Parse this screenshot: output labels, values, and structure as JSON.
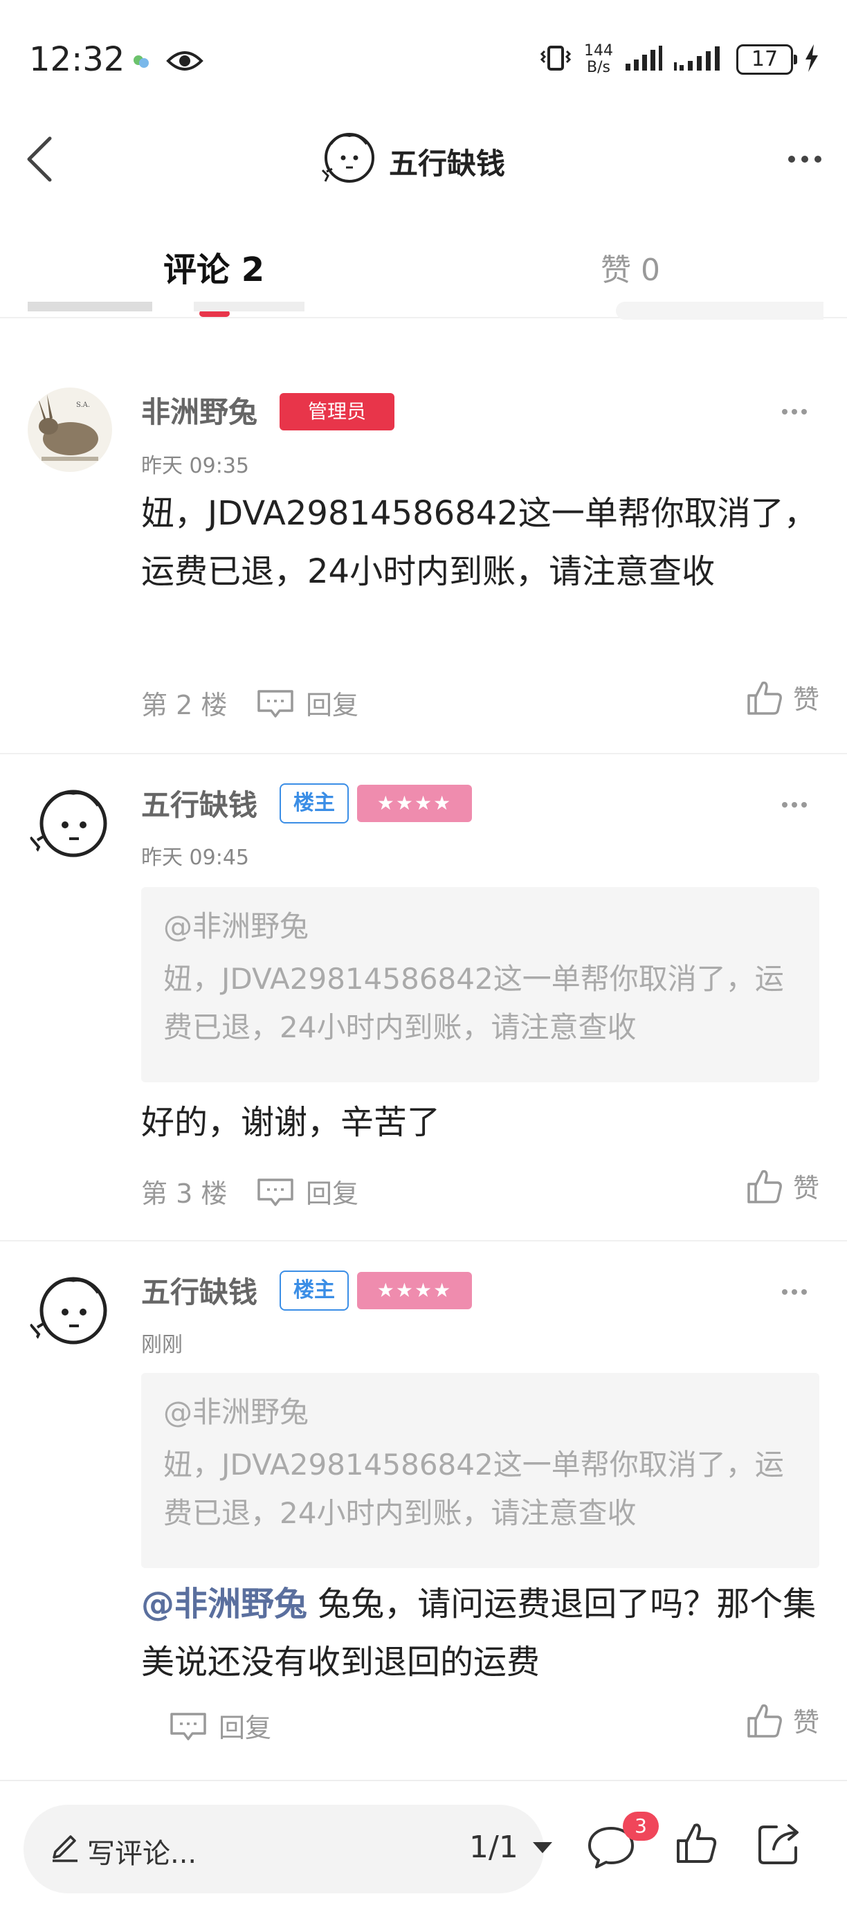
{
  "status_bar": {
    "time": "12:32",
    "net_speed_value": "144",
    "net_speed_unit": "B/s",
    "battery": "17"
  },
  "nav": {
    "title": "五行缺钱"
  },
  "tabs": {
    "comments": "评论 2",
    "likes": "赞 0"
  },
  "comments": [
    {
      "username": "非洲野兔",
      "badge": "管理员",
      "time": "昨天 09:35",
      "body": "妞，JDVA29814586842这一单帮你取消了，运费已退，24小时内到账，请注意查收",
      "floor": "第 2 楼",
      "reply": "回复",
      "like": "赞"
    },
    {
      "username": "五行缺钱",
      "badge": "楼主",
      "stars": "★★★★",
      "time": "昨天 09:45",
      "quote_user": "@非洲野兔",
      "quote_text": "妞，JDVA29814586842这一单帮你取消了，运费已退，24小时内到账，请注意查收",
      "body": "好的，谢谢，辛苦了",
      "floor": "第 3 楼",
      "reply": "回复",
      "like": "赞"
    },
    {
      "username": "五行缺钱",
      "badge": "楼主",
      "stars": "★★★★",
      "time": "刚刚",
      "quote_user": "@非洲野兔",
      "quote_text": "妞，JDVA29814586842这一单帮你取消了，运费已退，24小时内到账，请注意查收",
      "mention": "@非洲野兔",
      "body": " 兔兔，请问运费退回了吗？那个集美说还没有收到退回的运费",
      "reply": "回复",
      "like": "赞"
    }
  ],
  "bottom_bar": {
    "write_placeholder": "写评论...",
    "page_indicator": "1/1",
    "comment_count": "3"
  },
  "colors": {
    "accent_red": "#e8354a",
    "owner_blue": "#3b8ee6",
    "stars_pink": "#ef8cae",
    "mention_blue": "#5a6f9e"
  }
}
